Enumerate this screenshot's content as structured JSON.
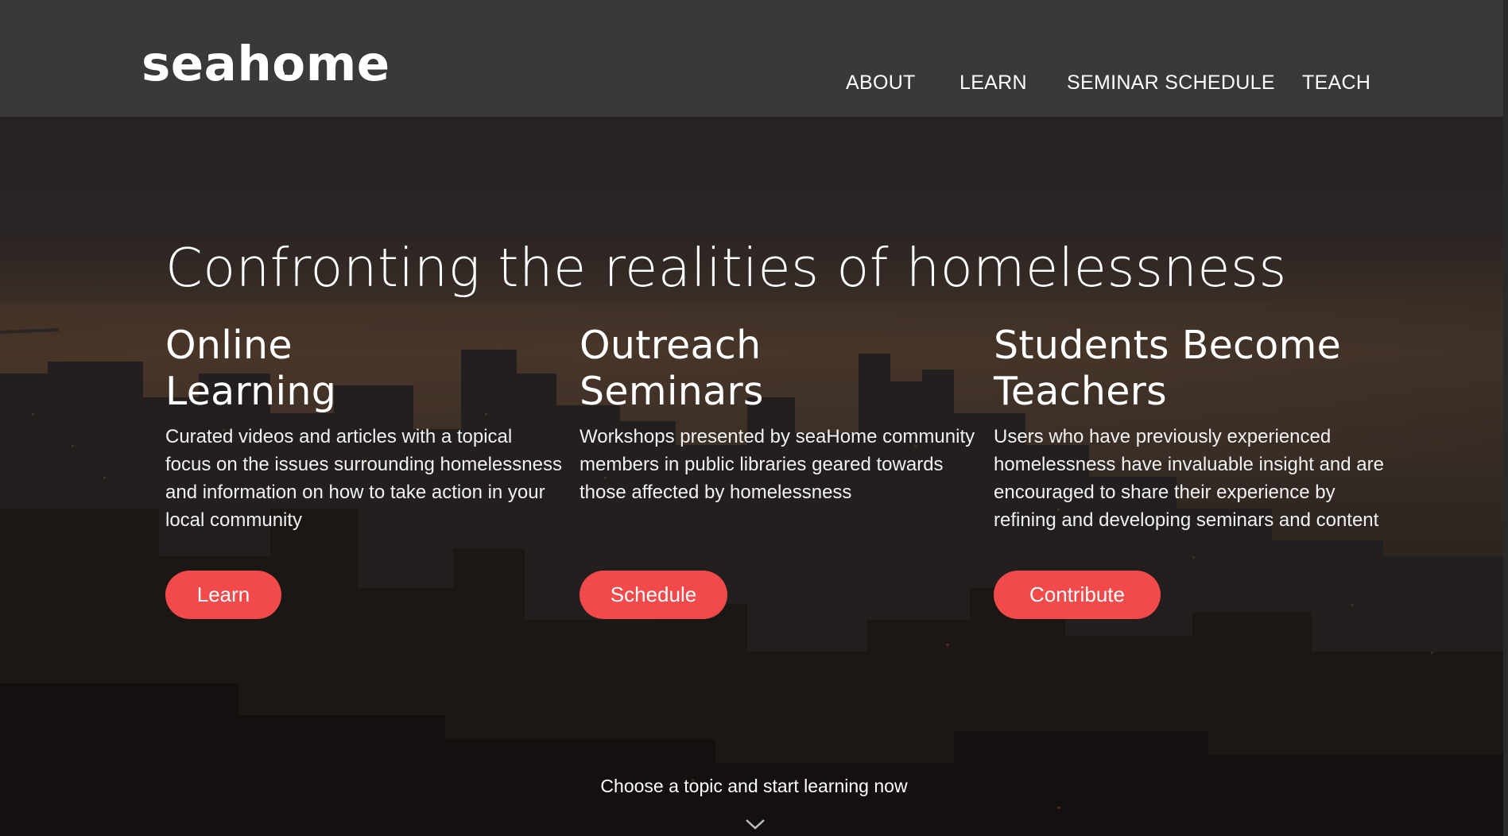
{
  "brand": {
    "logo_text_before": "seah",
    "logo_text_after": "me"
  },
  "nav": {
    "items": [
      {
        "label": "ABOUT"
      },
      {
        "label": "LEARN"
      },
      {
        "label": "SEMINAR SCHEDULE"
      },
      {
        "label": "TEACH"
      }
    ]
  },
  "hero": {
    "title": "Confronting the realities of homelessness",
    "columns": [
      {
        "heading_line1": "Online",
        "heading_line2": "Learning",
        "body": "Curated videos and articles with a topical focus on the issues surrounding homelessness and information on how to take action in your local community",
        "button": "Learn"
      },
      {
        "heading_line1": "Outreach",
        "heading_line2": "Seminars",
        "body": "Workshops presented by seaHome community members in public libraries geared towards those affected by homelessness",
        "button": "Schedule"
      },
      {
        "heading_line1": "Students Become",
        "heading_line2": "Teachers",
        "body": "Users who have previously experienced homelessness have invaluable insight and are encouraged to share their experience by refining and developing seminars and content",
        "button": "Contribute"
      }
    ],
    "cta_text": "Choose a topic and start learning now"
  },
  "colors": {
    "header_bg": "#393939",
    "accent": "#f24a4a",
    "text": "#ffffff"
  },
  "icons": {
    "scroll_down": "chevron-down-icon",
    "logo_house": "house-icon"
  }
}
